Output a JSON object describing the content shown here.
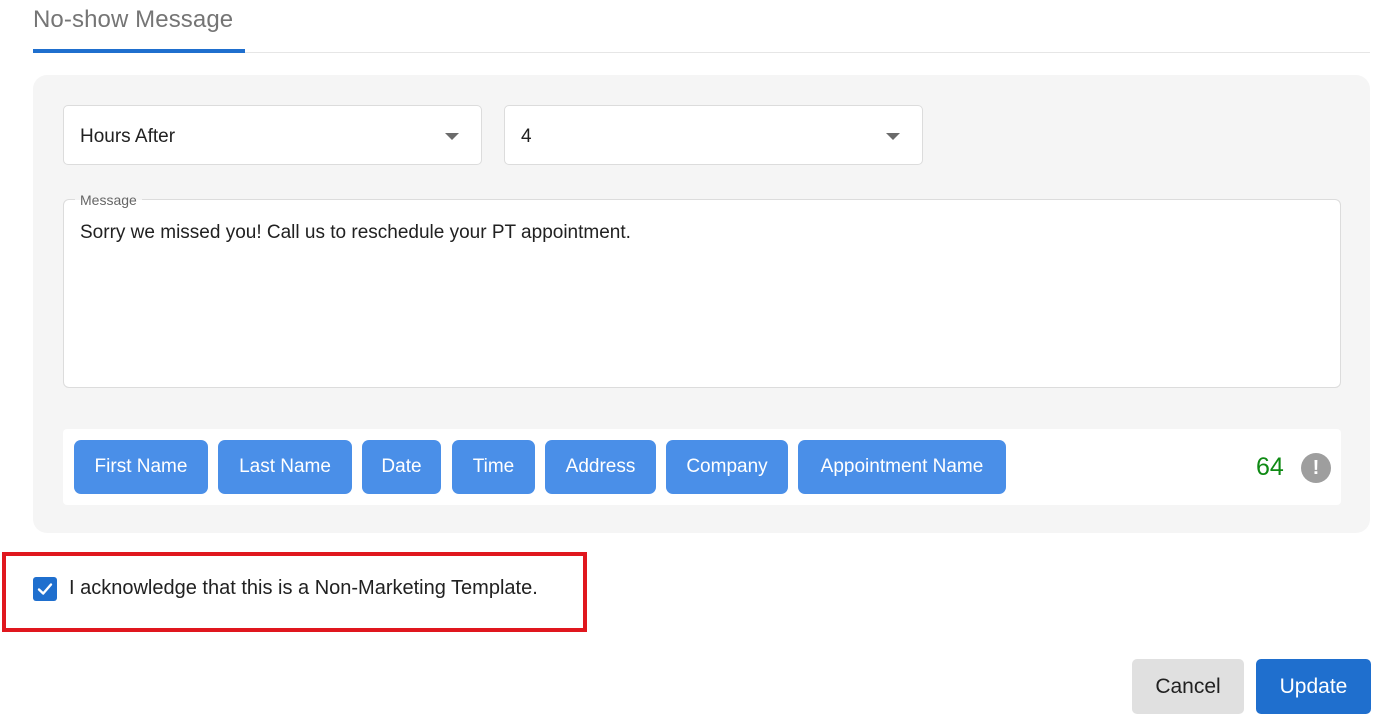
{
  "tab": {
    "title": "No-show Message"
  },
  "timing": {
    "unit": {
      "value": "Hours After",
      "icon": "caret-down-icon"
    },
    "amount": {
      "value": "4",
      "icon": "caret-down-icon"
    }
  },
  "message": {
    "label": "Message",
    "text": "Sorry we missed you! Call us to reschedule your PT appointment."
  },
  "tags": [
    {
      "label": "First Name"
    },
    {
      "label": "Last Name"
    },
    {
      "label": "Date"
    },
    {
      "label": "Time"
    },
    {
      "label": "Address"
    },
    {
      "label": "Company"
    },
    {
      "label": "Appointment Name"
    }
  ],
  "counter": {
    "value": "64",
    "color": "#0f8a14",
    "icon_glyph": "!",
    "icon": "info-icon"
  },
  "acknowledge": {
    "checked": true,
    "text": "I acknowledge that this is a Non-Marketing Template.",
    "highlight_color": "#e0171e"
  },
  "actions": {
    "cancel_label": "Cancel",
    "update_label": "Update"
  },
  "colors": {
    "accent": "#1f6fce",
    "tag": "#4a8fe8"
  }
}
